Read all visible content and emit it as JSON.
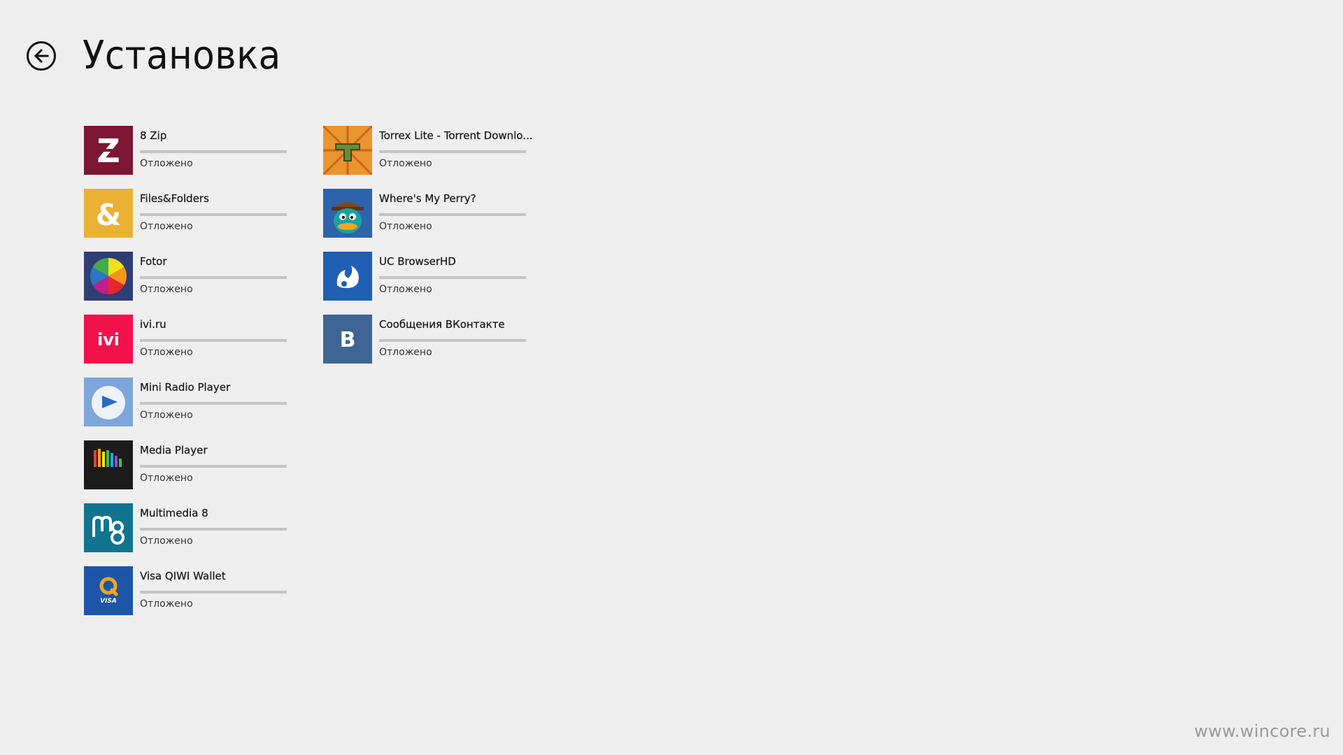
{
  "header": {
    "title": "Установка",
    "back_icon": "back-arrow-icon"
  },
  "columns": [
    {
      "items": [
        {
          "name": "8 Zip",
          "status": "Отложено",
          "progress": 0,
          "icon": "8zip-icon",
          "color": "#7d1535"
        },
        {
          "name": "Files&Folders",
          "status": "Отложено",
          "progress": 0,
          "icon": "files-folders-icon",
          "color": "#eab135"
        },
        {
          "name": "Fotor",
          "status": "Отложено",
          "progress": 0,
          "icon": "fotor-icon",
          "color": "#2f3d72"
        },
        {
          "name": "ivi.ru",
          "status": "Отложено",
          "progress": 0,
          "icon": "ivi-icon",
          "color": "#f0124d"
        },
        {
          "name": "Mini Radio Player",
          "status": "Отложено",
          "progress": 0,
          "icon": "mini-radio-icon",
          "color": "#7fa6da"
        },
        {
          "name": "Media Player",
          "status": "Отложено",
          "progress": 0,
          "icon": "media-player-icon",
          "color": "#1b1b1b"
        },
        {
          "name": "Multimedia 8",
          "status": "Отложено",
          "progress": 0,
          "icon": "multimedia8-icon",
          "color": "#11748f"
        },
        {
          "name": "Visa QIWI Wallet",
          "status": "Отложено",
          "progress": 0,
          "icon": "qiwi-icon",
          "color": "#1d56a8"
        }
      ]
    },
    {
      "items": [
        {
          "name": "Torrex Lite - Torrent Downlo...",
          "status": "Отложено",
          "progress": 0,
          "icon": "torrex-icon",
          "color": "#e8962e"
        },
        {
          "name": "Where's My Perry?",
          "status": "Отложено",
          "progress": 0,
          "icon": "perry-icon",
          "color": "#2d63ac"
        },
        {
          "name": "UC BrowserHD",
          "status": "Отложено",
          "progress": 0,
          "icon": "uc-browser-icon",
          "color": "#1f5fb4"
        },
        {
          "name": "Сообщения ВКонтакте",
          "status": "Отложено",
          "progress": 0,
          "icon": "vk-icon",
          "color": "#3f6594"
        }
      ]
    }
  ],
  "watermark": "www.wincore.ru"
}
